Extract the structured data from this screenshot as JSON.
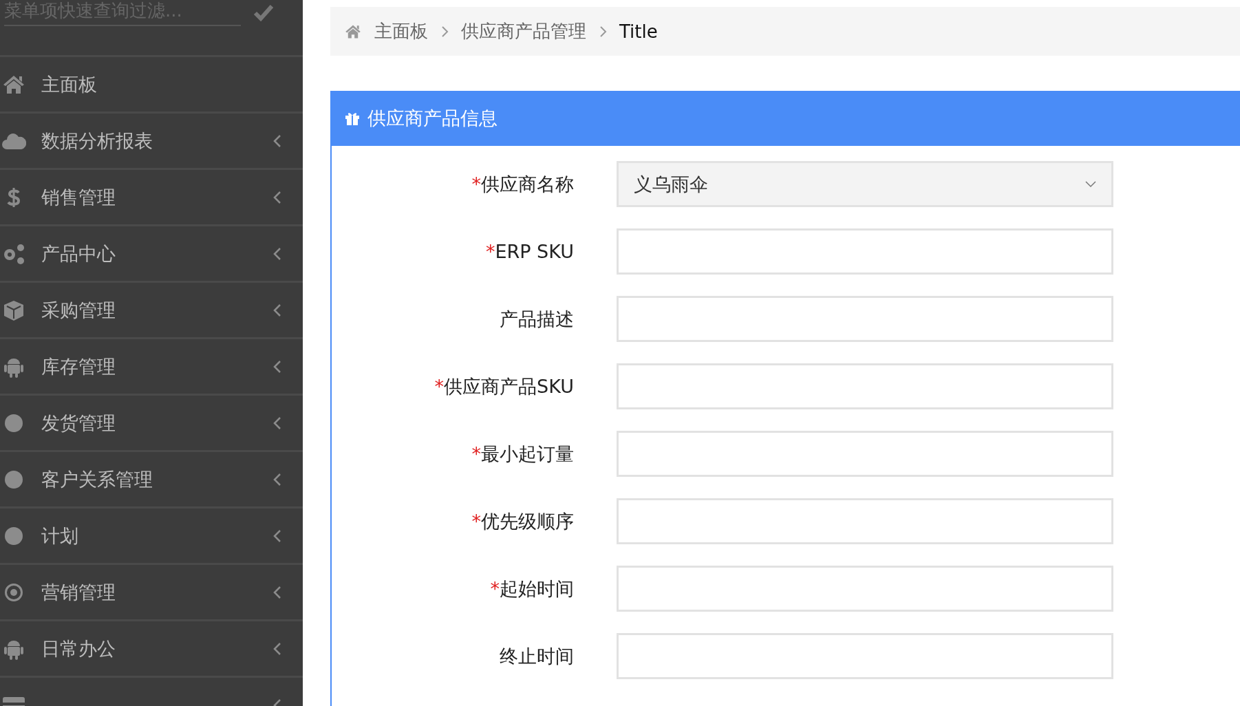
{
  "sidebar": {
    "search": {
      "placeholder": "菜单项快速查询过滤..."
    },
    "items": [
      {
        "label": "主面板",
        "kind": "home",
        "has_children": false
      },
      {
        "label": "数据分析报表",
        "kind": "cloud",
        "has_children": true
      },
      {
        "label": "销售管理",
        "kind": "dollar",
        "has_children": true
      },
      {
        "label": "产品中心",
        "kind": "gears",
        "has_children": true
      },
      {
        "label": "采购管理",
        "kind": "cube",
        "has_children": true
      },
      {
        "label": "库存管理",
        "kind": "android",
        "has_children": true
      },
      {
        "label": "发货管理",
        "kind": "circle",
        "has_children": true
      },
      {
        "label": "客户关系管理",
        "kind": "circle",
        "has_children": true
      },
      {
        "label": "计划",
        "kind": "circle",
        "has_children": true
      },
      {
        "label": "营销管理",
        "kind": "target",
        "has_children": true
      },
      {
        "label": "日常办公",
        "kind": "android",
        "has_children": true
      },
      {
        "kind": "card",
        "has_children": true
      }
    ]
  },
  "breadcrumb": [
    "主面板",
    "供应商产品管理",
    "Title"
  ],
  "panel": {
    "title": "供应商产品信息",
    "fields": [
      {
        "required_mark": "*",
        "label": "供应商名称",
        "kind": "select",
        "value": "义乌雨伞"
      },
      {
        "required_mark": "*",
        "label": "ERP SKU",
        "kind": "text"
      },
      {
        "label": "产品描述",
        "kind": "text"
      },
      {
        "required_mark": "*",
        "label": "供应商产品SKU",
        "kind": "text"
      },
      {
        "required_mark": "*",
        "label": "最小起订量",
        "kind": "text"
      },
      {
        "required_mark": "*",
        "label": "优先级顺序",
        "kind": "text"
      },
      {
        "required_mark": "*",
        "label": "起始时间",
        "kind": "text"
      },
      {
        "label": "终止时间",
        "kind": "text"
      }
    ]
  }
}
